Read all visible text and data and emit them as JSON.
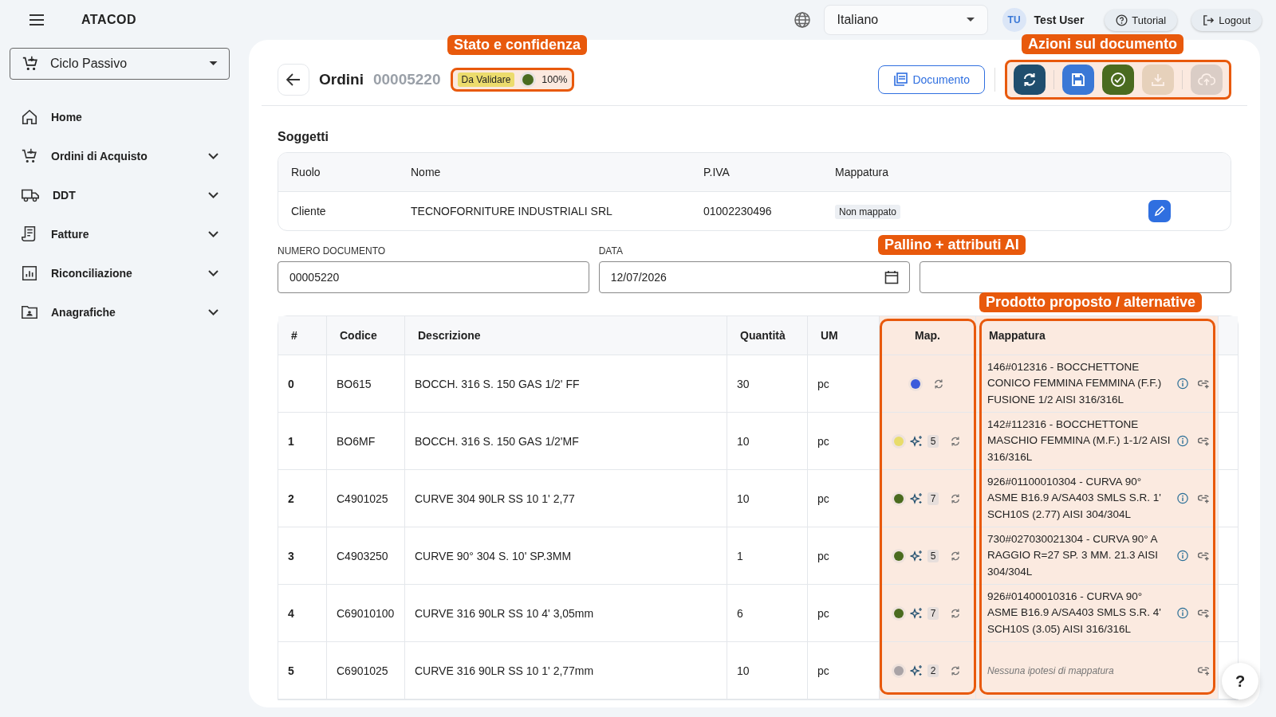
{
  "app": {
    "name": "ATACOD"
  },
  "cycle_select": {
    "value": "Ciclo Passivo"
  },
  "sidebar": {
    "items": [
      {
        "kind": "home",
        "label": "Home",
        "expandable": false
      },
      {
        "kind": "cart",
        "label": "Ordini di Acquisto",
        "expandable": true
      },
      {
        "kind": "truck",
        "label": "DDT",
        "expandable": true
      },
      {
        "kind": "receipt",
        "label": "Fatture",
        "expandable": true
      },
      {
        "kind": "chart",
        "label": "Riconciliazione",
        "expandable": true
      },
      {
        "kind": "folder",
        "label": "Anagrafiche",
        "expandable": true
      }
    ]
  },
  "topbar": {
    "language": "Italiano",
    "user": {
      "initials": "TU",
      "name": "Test User"
    },
    "buttons": [
      {
        "kind": "tutorial",
        "label": "Tutorial"
      },
      {
        "kind": "logout",
        "label": "Logout"
      }
    ]
  },
  "page": {
    "title": "Ordini",
    "number": "00005220",
    "status": "Da Validare",
    "confidence": {
      "color": "#4a6b1f",
      "value": "100%"
    },
    "document_button": "Documento",
    "actions": [
      {
        "kind": "refresh",
        "disabled": false
      },
      {
        "kind": "save",
        "disabled": false
      },
      {
        "kind": "validate",
        "disabled": false
      },
      {
        "kind": "download",
        "disabled": true
      },
      {
        "kind": "upload",
        "disabled": true
      }
    ]
  },
  "subjects": {
    "title": "Soggetti",
    "columns": [
      "Ruolo",
      "Nome",
      "P.IVA",
      "Mappatura"
    ],
    "rows": [
      {
        "role": "Cliente",
        "name": "TECNOFORNITURE INDUSTRIALI SRL",
        "vat": "01002230496",
        "mapping": "Non mappato"
      }
    ]
  },
  "fields": [
    {
      "kind": "text",
      "label": "NUMERO DOCUMENTO",
      "value": "00005220"
    },
    {
      "kind": "date",
      "label": "DATA",
      "value": "12/07/2026"
    },
    {
      "kind": "text"
    }
  ],
  "lines": {
    "columns": [
      "#",
      "Codice",
      "Descrizione",
      "Quantità",
      "UM",
      "Map.",
      "Mappatura"
    ],
    "rows": [
      {
        "index": "0",
        "code": "BO615",
        "description": "BOCCH. 316 S. 150 GAS 1/2' FF",
        "quantity": "30",
        "unit": "pc",
        "color": "#3b5bdb",
        "mapping": "146#012316 - BOCCHETTONE CONICO FEMMINA FEMMINA (F.F.) FUSIONE 1/2 AISI 316/316L"
      },
      {
        "index": "1",
        "code": "BO6MF",
        "description": "BOCCH. 316 S. 150 GAS 1/2'MF",
        "quantity": "10",
        "unit": "pc",
        "color": "#e8dc6a",
        "ai_count": "5",
        "mapping": "142#112316 - BOCCHETTONE MASCHIO FEMMINA (M.F.) 1-1/2 AISI 316/316L"
      },
      {
        "index": "2",
        "code": "C4901025",
        "description": "CURVE 304 90LR SS 10 1' 2,77",
        "quantity": "10",
        "unit": "pc",
        "color": "#4a6b1f",
        "ai_count": "7",
        "mapping": "926#01100010304 - CURVA 90° ASME B16.9 A/SA403 SMLS S.R. 1' SCH10S (2.77) AISI 304/304L"
      },
      {
        "index": "3",
        "code": "C4903250",
        "description": "CURVE 90° 304 S. 10' SP.3MM",
        "quantity": "1",
        "unit": "pc",
        "color": "#4a6b1f",
        "ai_count": "5",
        "mapping": "730#027030021304 - CURVA 90° A RAGGIO R=27 SP. 3 MM. 21.3 AISI 304/304L"
      },
      {
        "index": "4",
        "code": "C69010100",
        "description": "CURVE 316 90LR SS 10 4' 3,05mm",
        "quantity": "6",
        "unit": "pc",
        "color": "#4a6b1f",
        "ai_count": "7",
        "mapping": "926#01400010316 - CURVA 90° ASME B16.9 A/SA403 SMLS S.R. 4' SCH10S (3.05) AISI 316/316L"
      },
      {
        "index": "5",
        "code": "C6901025",
        "description": "CURVE 316 90LR SS 10 1' 2,77mm",
        "quantity": "10",
        "unit": "pc",
        "color": "#a9a3a6",
        "ai_count": "2",
        "empty_text": "Nessuna ipotesi di mappatura"
      }
    ]
  },
  "callouts": [
    {
      "kind": "status",
      "text": "Stato e confidenza"
    },
    {
      "kind": "actions",
      "text": "Azioni sul documento"
    },
    {
      "kind": "map_column",
      "text": "Pallino + attributi AI"
    },
    {
      "kind": "mapping_column",
      "text": "Prodotto proposto / alternative"
    }
  ],
  "help": {
    "label": "?"
  }
}
